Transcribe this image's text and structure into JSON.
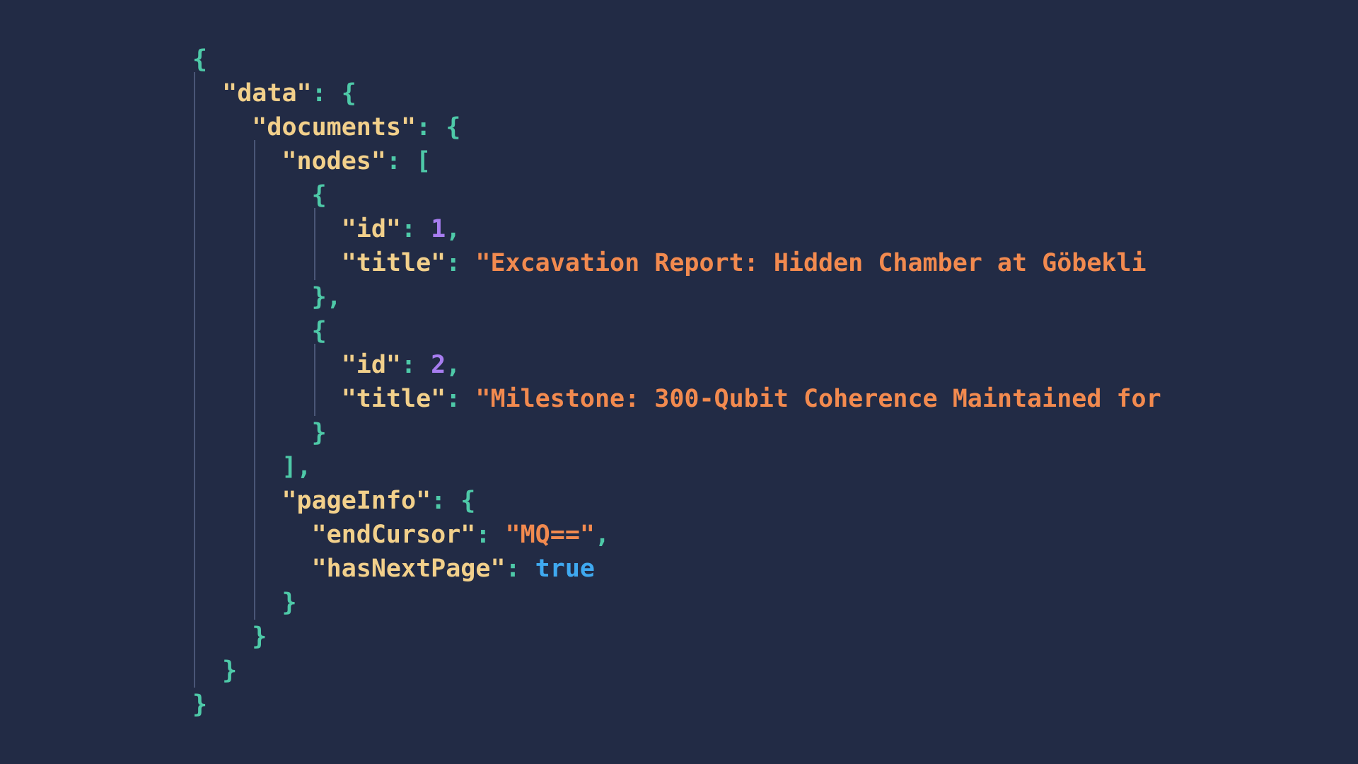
{
  "code": {
    "lines": [
      [
        {
          "t": "{",
          "c": "punc"
        }
      ],
      [
        {
          "t": "  "
        },
        {
          "t": "\"data\"",
          "c": "key"
        },
        {
          "t": ": {",
          "c": "punc"
        }
      ],
      [
        {
          "t": "    "
        },
        {
          "t": "\"documents\"",
          "c": "key"
        },
        {
          "t": ": {",
          "c": "punc"
        }
      ],
      [
        {
          "t": "      "
        },
        {
          "t": "\"nodes\"",
          "c": "key"
        },
        {
          "t": ": [",
          "c": "punc"
        }
      ],
      [
        {
          "t": "        "
        },
        {
          "t": "{",
          "c": "punc"
        }
      ],
      [
        {
          "t": "          "
        },
        {
          "t": "\"id\"",
          "c": "key"
        },
        {
          "t": ": ",
          "c": "punc"
        },
        {
          "t": "1",
          "c": "num"
        },
        {
          "t": ",",
          "c": "punc"
        }
      ],
      [
        {
          "t": "          "
        },
        {
          "t": "\"title\"",
          "c": "key"
        },
        {
          "t": ": ",
          "c": "punc"
        },
        {
          "t": "\"Excavation Report: Hidden Chamber at Göbekli",
          "c": "str"
        }
      ],
      [
        {
          "t": "        "
        },
        {
          "t": "},",
          "c": "punc"
        }
      ],
      [
        {
          "t": "        "
        },
        {
          "t": "{",
          "c": "punc"
        }
      ],
      [
        {
          "t": "          "
        },
        {
          "t": "\"id\"",
          "c": "key"
        },
        {
          "t": ": ",
          "c": "punc"
        },
        {
          "t": "2",
          "c": "num"
        },
        {
          "t": ",",
          "c": "punc"
        }
      ],
      [
        {
          "t": "          "
        },
        {
          "t": "\"title\"",
          "c": "key"
        },
        {
          "t": ": ",
          "c": "punc"
        },
        {
          "t": "\"Milestone: 300-Qubit Coherence Maintained for",
          "c": "str"
        }
      ],
      [
        {
          "t": "        "
        },
        {
          "t": "}",
          "c": "punc"
        }
      ],
      [
        {
          "t": "      "
        },
        {
          "t": "],",
          "c": "punc"
        }
      ],
      [
        {
          "t": "      "
        },
        {
          "t": "\"pageInfo\"",
          "c": "key"
        },
        {
          "t": ": {",
          "c": "punc"
        }
      ],
      [
        {
          "t": "        "
        },
        {
          "t": "\"endCursor\"",
          "c": "key"
        },
        {
          "t": ": ",
          "c": "punc"
        },
        {
          "t": "\"MQ==\"",
          "c": "str"
        },
        {
          "t": ",",
          "c": "punc"
        }
      ],
      [
        {
          "t": "        "
        },
        {
          "t": "\"hasNextPage\"",
          "c": "key"
        },
        {
          "t": ": ",
          "c": "punc"
        },
        {
          "t": "true",
          "c": "bool"
        }
      ],
      [
        {
          "t": "      "
        },
        {
          "t": "}",
          "c": "punc"
        }
      ],
      [
        {
          "t": "    "
        },
        {
          "t": "}",
          "c": "punc"
        }
      ],
      [
        {
          "t": "  "
        },
        {
          "t": "}",
          "c": "punc"
        }
      ],
      [
        {
          "t": "}",
          "c": "punc"
        }
      ]
    ]
  },
  "colors": {
    "background": "#222b45",
    "punctuation": "#4ec9a8",
    "key": "#f2d08b",
    "string": "#f28a4f",
    "number": "#a77df0",
    "boolean": "#3fa9f0",
    "indent_guide": "#4a5677"
  }
}
